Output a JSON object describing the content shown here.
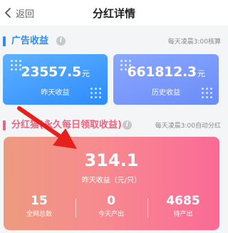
{
  "header": {
    "back_label": "返回",
    "title": "分红详情"
  },
  "ad_section": {
    "title": "广告收益",
    "note": "每天凌晨3:00核算",
    "cards": [
      {
        "value": "23557.5",
        "unit": "元",
        "label": "昨天收益",
        "color": "#2d8bfb"
      },
      {
        "value": "661812.3",
        "unit": "元",
        "label": "历史收益",
        "color": "#6b8cf8"
      }
    ]
  },
  "dividend_section": {
    "title": "分红猫(永久每日领取收益)",
    "note": "每天凌晨3:00自动分红",
    "yesterday_value": "314.1",
    "yesterday_label": "昨天收益（元/只）",
    "stats": [
      {
        "value": "15",
        "label": "全网总数"
      },
      {
        "value": "0",
        "label": "今天产出"
      },
      {
        "value": "4685",
        "label": "待产出"
      }
    ]
  },
  "colors": {
    "accent_blue": "#2d8bfb",
    "accent_pink": "#f0637e",
    "arrow_red": "#e8201c"
  },
  "icons": [
    "chevron-left-icon",
    "info-icon",
    "dots-decoration-icon",
    "arrow-pointer-icon"
  ]
}
